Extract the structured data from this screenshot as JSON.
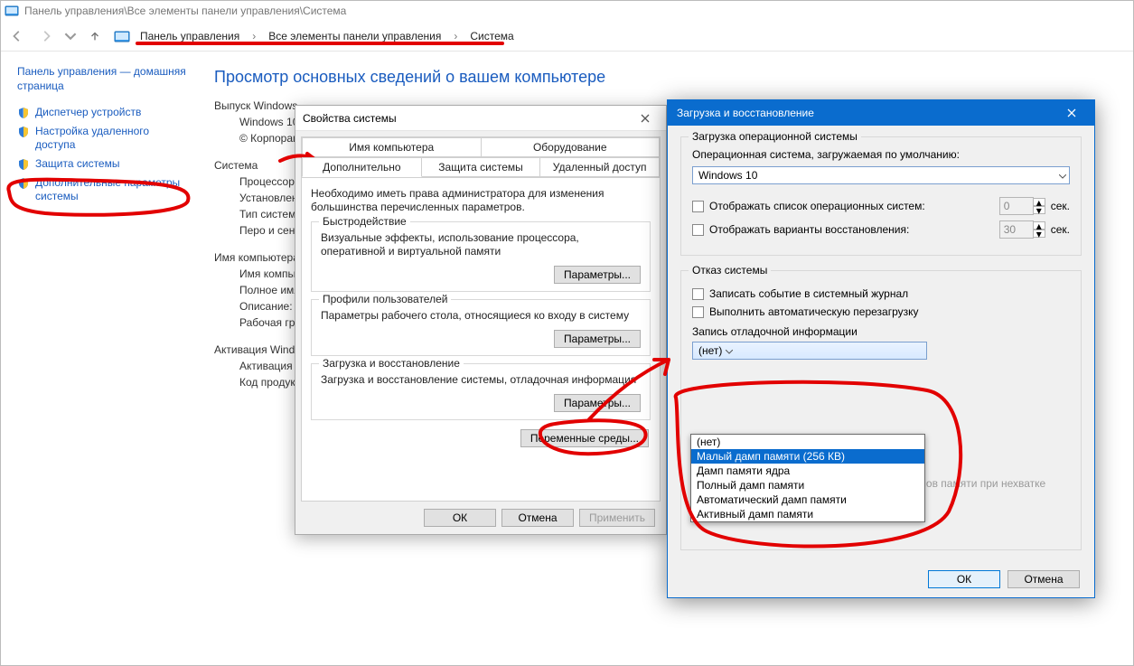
{
  "controlPanel": {
    "titlebar": "Панель управления\\Все элементы панели управления\\Система",
    "breadcrumb": {
      "p1": "Панель управления",
      "p2": "Все элементы панели управления",
      "p3": "Система",
      "sep": "›"
    },
    "sidebar": {
      "home": "Панель управления — домашняя страница",
      "links": [
        {
          "label": "Диспетчер устройств"
        },
        {
          "label": "Настройка удаленного доступа"
        },
        {
          "label": "Защита системы"
        },
        {
          "label": "Дополнительные параметры системы"
        }
      ]
    },
    "content": {
      "heading": "Просмотр основных сведений о вашем компьютере",
      "sec_edition": "Выпуск Windows",
      "edition_line1": "Windows 10",
      "edition_line2": "© Корпорация",
      "sec_system": "Система",
      "sys_lines": {
        "cpu": "Процессор:",
        "ram": "Установленная память (ОЗУ):",
        "type": "Тип системы:",
        "pen": "Перо и сенсор:"
      },
      "sec_name": "Имя компьютера",
      "name_lines": {
        "short": "Имя компьютера:",
        "full": "Полное имя:",
        "desc": "Описание:",
        "wg": "Рабочая группа"
      },
      "sec_act": "Активация Windows",
      "act_line": "Активация Windows",
      "prod_line": "Код продукта"
    }
  },
  "sysProps": {
    "title": "Свойства системы",
    "tabs": {
      "row1": {
        "a": "Имя компьютера",
        "b": "Оборудование"
      },
      "row2": {
        "a": "Дополнительно",
        "b": "Защита системы",
        "c": "Удаленный доступ"
      }
    },
    "note": "Необходимо иметь права администратора для изменения большинства перечисленных параметров.",
    "groups": {
      "perf": {
        "title": "Быстродействие",
        "desc": "Визуальные эффекты, использование процессора, оперативной и виртуальной памяти",
        "btn": "Параметры..."
      },
      "profiles": {
        "title": "Профили пользователей",
        "desc": "Параметры рабочего стола, относящиеся ко входу в систему",
        "btn": "Параметры..."
      },
      "startup": {
        "title": "Загрузка и восстановление",
        "desc": "Загрузка и восстановление системы, отладочная информация",
        "btn": "Параметры..."
      }
    },
    "env_btn": "Переменные среды...",
    "ok": "ОК",
    "cancel": "Отмена",
    "apply": "Применить"
  },
  "startupRecovery": {
    "title": "Загрузка и восстановление",
    "group_boot": {
      "title": "Загрузка операционной системы",
      "default_label": "Операционная система, загружаемая по умолчанию:",
      "default_value": "Windows 10",
      "opt_list": "Отображать список операционных систем:",
      "opt_list_seconds": "0",
      "opt_recov": "Отображать варианты восстановления:",
      "opt_recov_seconds": "30",
      "sec_suffix": "сек."
    },
    "group_fail": {
      "title": "Отказ системы",
      "write_event": "Записать событие в системный журнал",
      "auto_restart": "Выполнить автоматическую перезагрузку",
      "dump_label": "Запись отладочной информации",
      "dump_value": "(нет)",
      "dump_options": [
        "(нет)",
        "Малый дамп памяти (256 КВ)",
        "Дамп памяти ядра",
        "Полный дамп памяти",
        "Автоматический дамп памяти",
        "Активный дамп памяти"
      ],
      "dump_selected_index": 1,
      "disable_auto_delete": "Отключить автоматическое удаление дампов памяти при нехватке места на диске"
    },
    "ok": "ОК",
    "cancel": "Отмена"
  }
}
